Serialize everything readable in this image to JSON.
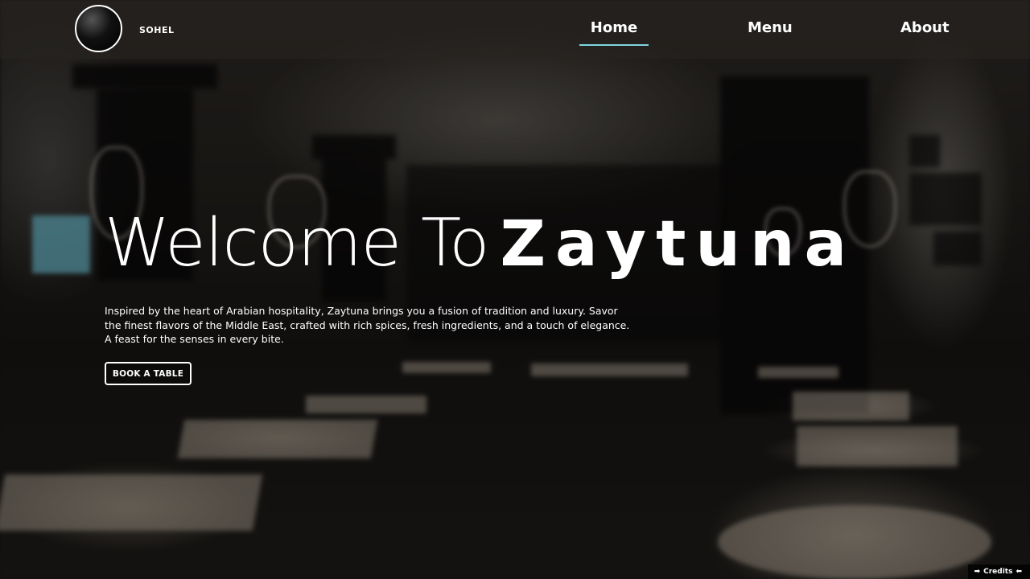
{
  "header": {
    "brand": "SOHEL",
    "nav": [
      {
        "label": "Home",
        "active": true
      },
      {
        "label": "Menu",
        "active": false
      },
      {
        "label": "About",
        "active": false
      }
    ]
  },
  "hero": {
    "title_light": "Welcome To",
    "title_bold": "Zaytuna",
    "description": "Inspired by the heart of Arabian hospitality, Zaytuna brings you a fusion of tradition and luxury. Savor the finest flavors of the Middle East, crafted with rich spices, fresh ingredients, and a touch of elegance. A feast for the senses in every bite.",
    "cta_label": "BOOK A TABLE"
  },
  "footer": {
    "credits_label": "Credits",
    "credits_left_icon": "arrow-right-icon",
    "credits_right_icon": "arrow-left-icon"
  },
  "colors": {
    "active_underline": "#7fd6e0",
    "text": "#ffffff"
  }
}
